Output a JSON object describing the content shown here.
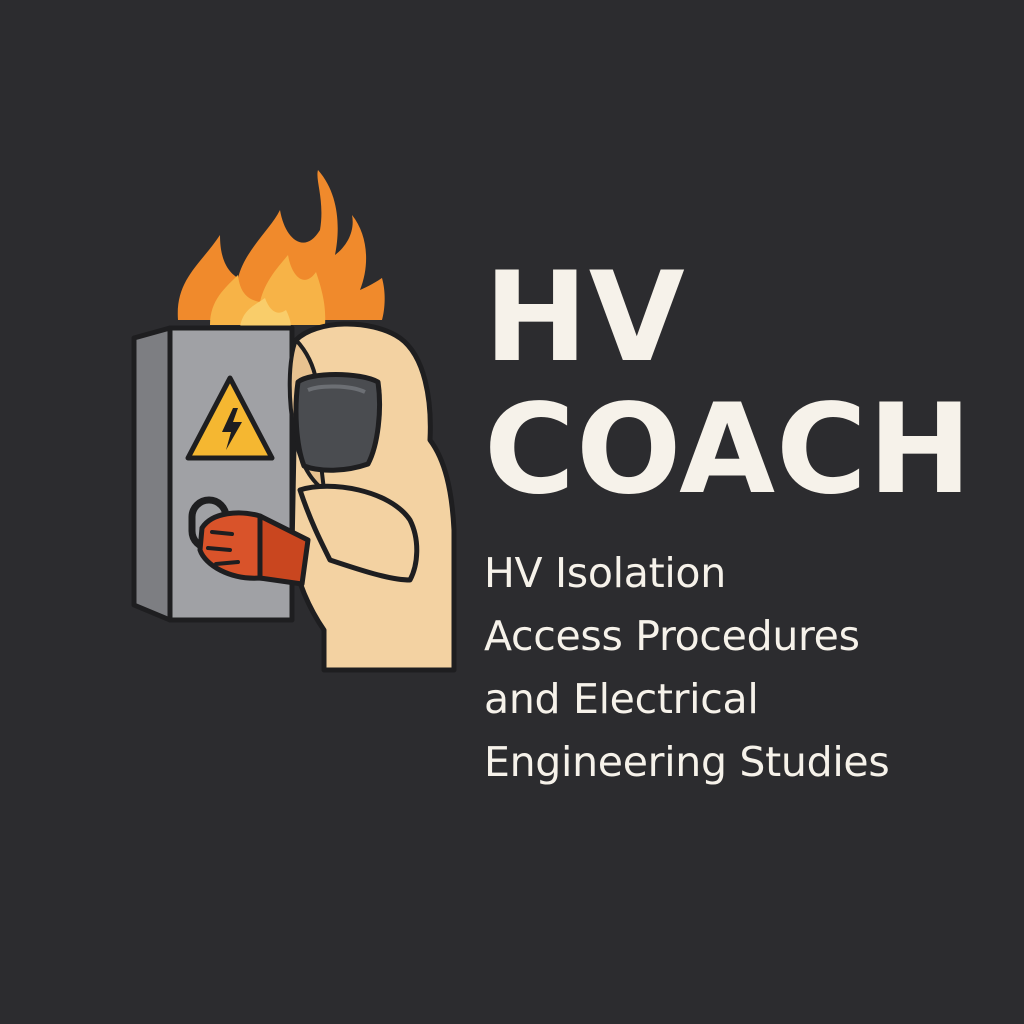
{
  "logo": {
    "title_lines": [
      "HV",
      "COACH"
    ],
    "tagline_lines": [
      "HV Isolation",
      "Access Procedures",
      "and Electrical",
      "Engineering Studies"
    ]
  },
  "illustration": {
    "icons": [
      "flame-icon",
      "switchgear-cabinet",
      "high-voltage-warning-icon",
      "padlock-handle-icon",
      "arc-flash-suit-worker"
    ]
  },
  "colors": {
    "background": "#2c2c2f",
    "text": "#f6f2ea",
    "flame_outer": "#f08a2c",
    "flame_inner": "#f7b347",
    "cabinet": "#9a9b9f",
    "suit": "#f3d2a2",
    "glove": "#d9532a",
    "warning": "#f5b731"
  }
}
